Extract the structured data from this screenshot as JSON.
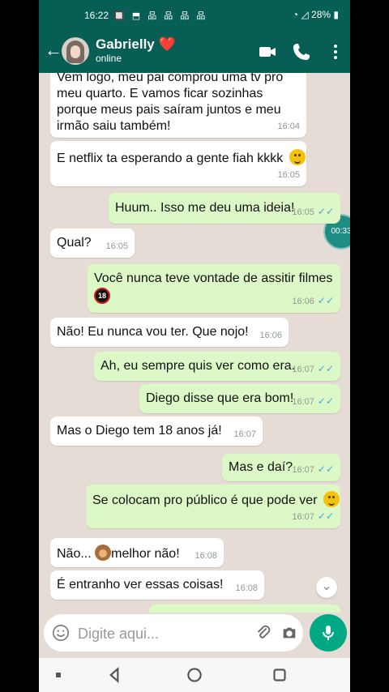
{
  "statusbar": {
    "time": "16:22",
    "battery": "28%",
    "notification_icons": "🔲 ⬒ 品 品 品 品"
  },
  "header": {
    "contact_name": "Gabrielly",
    "contact_emoji": "❤️",
    "contact_status": "online"
  },
  "messages": [
    {
      "direction": "in",
      "text": "Vem logo, meu pai comprou uma tv pro meu quarto. E vamos ficar sozinhas porque meus pais saíram juntos e meu irmão saiu também!",
      "time": "16:04"
    },
    {
      "direction": "in",
      "text": "E netflix ta esperando a gente fiah kkkk",
      "time": "16:05",
      "emoji": "slight-smile-emoji"
    },
    {
      "direction": "out",
      "text": "Huum.. Isso me deu uma ideia!",
      "time": "16:05"
    },
    {
      "direction": "in",
      "text": "Qual?",
      "time": "16:05"
    },
    {
      "direction": "out",
      "text": "Você nunca teve vontade de assitir filmes",
      "time": "16:06",
      "emoji": "no-under-18-emoji"
    },
    {
      "direction": "in",
      "text": "Não! Eu nunca vou ter. Que nojo!",
      "time": "16:06"
    },
    {
      "direction": "out",
      "text": "Ah, eu sempre quis ver como era.",
      "time": "16:07"
    },
    {
      "direction": "out",
      "text": "Diego disse que era bom!",
      "time": "16:07"
    },
    {
      "direction": "in",
      "text": "Mas o Diego tem 18 anos já!",
      "time": "16:07"
    },
    {
      "direction": "out",
      "text": "Mas e daí?",
      "time": "16:07"
    },
    {
      "direction": "out",
      "text": "Se colocam pro público é que pode ver",
      "time": "16:07",
      "emoji": "slight-smile-emoji"
    },
    {
      "direction": "in",
      "text": "Não... ",
      "text_after": "melhor não!",
      "time": "16:08",
      "emoji": "see-no-evil-monkey-emoji"
    },
    {
      "direction": "in",
      "text": "É entranho ver essas coisas!",
      "time": "16:08"
    }
  ],
  "voice_overlay": {
    "time": "00:33"
  },
  "composer": {
    "placeholder": "Digite aqui..."
  },
  "colors": {
    "header": "#075e54",
    "outgoing": "#dcf8c6",
    "incoming": "#ffffff",
    "chat_background": "#e5ddd5",
    "accent": "#00a884",
    "read_check": "#4aa3df"
  },
  "icons": {
    "back": "back-arrow-icon",
    "video": "video-call-icon",
    "call": "voice-call-icon",
    "menu": "more-options-icon",
    "attach": "paperclip-icon",
    "camera": "camera-icon",
    "mic": "microphone-icon"
  }
}
